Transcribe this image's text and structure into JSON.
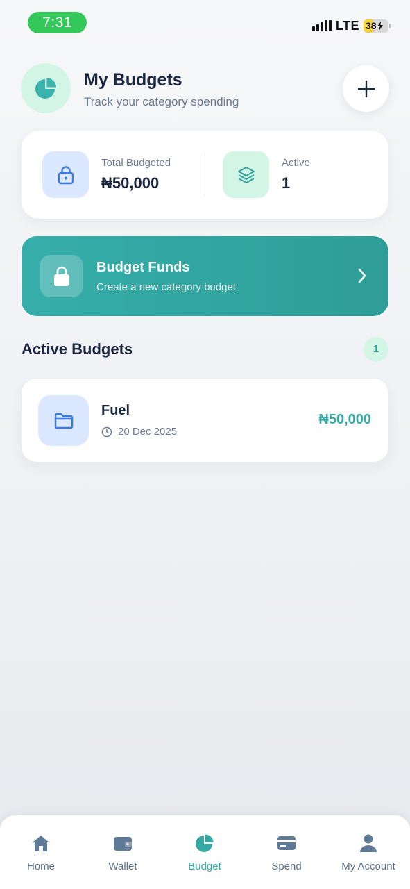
{
  "status_bar": {
    "time": "7:31",
    "network": "LTE",
    "battery": "38"
  },
  "header": {
    "title": "My Budgets",
    "subtitle": "Track your category spending",
    "icon": "pie-chart-icon",
    "add_icon": "plus-icon"
  },
  "summary": {
    "total_label": "Total Budgeted",
    "total_value": "₦50,000",
    "active_label": "Active",
    "active_value": "1"
  },
  "cta": {
    "title": "Budget Funds",
    "subtitle": "Create a new category budget"
  },
  "section": {
    "title": "Active Budgets",
    "count": "1"
  },
  "budgets": [
    {
      "name": "Fuel",
      "date": "20 Dec 2025",
      "amount": "₦50,000",
      "icon": "folder-icon"
    }
  ],
  "nav": {
    "items": [
      {
        "label": "Home",
        "icon": "home-icon"
      },
      {
        "label": "Wallet",
        "icon": "wallet-icon"
      },
      {
        "label": "Budget",
        "icon": "pie-chart-icon"
      },
      {
        "label": "Spend",
        "icon": "card-icon"
      },
      {
        "label": "My Account",
        "icon": "user-icon"
      }
    ],
    "active": "Budget"
  },
  "colors": {
    "accent": "#35a9a3",
    "mint": "#d3f5e6",
    "light_blue": "#dbe8ff",
    "status_green": "#34c759",
    "text_dark": "#1b2640",
    "text_muted": "#6b7a90"
  }
}
